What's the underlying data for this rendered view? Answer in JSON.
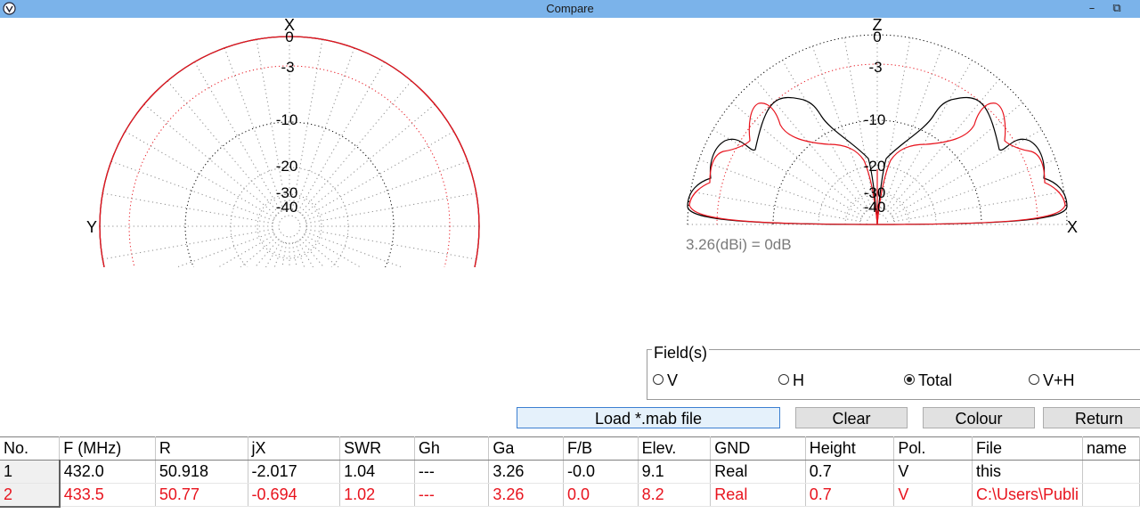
{
  "window": {
    "title": "Compare",
    "min_glyph": "–",
    "max_glyph": "⧉"
  },
  "azimuth_plot": {
    "top_axis": "X",
    "left_axis": "Y",
    "ring_labels": [
      "0",
      "-3",
      "-10",
      "-20",
      "-30",
      "-40"
    ]
  },
  "elevation_plot": {
    "top_axis": "Z",
    "right_axis": "X",
    "ring_labels": [
      "0",
      "-3",
      "-10",
      "-20",
      "-30",
      "-40"
    ],
    "reference": "3.26(dBi) = 0dB"
  },
  "fields": {
    "legend": "Field(s)",
    "options": [
      {
        "label": "V",
        "selected": false
      },
      {
        "label": "H",
        "selected": false
      },
      {
        "label": "Total",
        "selected": true
      },
      {
        "label": "V+H",
        "selected": false
      }
    ]
  },
  "buttons": {
    "load": "Load *.mab file",
    "clear": "Clear",
    "colour": "Colour",
    "return": "Return"
  },
  "table": {
    "headers": [
      "No.",
      "F (MHz)",
      "R",
      "jX",
      "SWR",
      "Gh",
      "Ga",
      "F/B",
      "Elev.",
      "GND",
      "Height",
      "Pol.",
      "File",
      "name"
    ],
    "rows": [
      [
        "1",
        "432.0",
        "50.918",
        "-2.017",
        "1.04",
        "---",
        "3.26",
        "-0.0",
        "9.1",
        "Real",
        "0.7",
        "V",
        "this",
        ""
      ],
      [
        "2",
        "433.5",
        "50.77",
        "-0.694",
        "1.02",
        "---",
        "3.26",
        "0.0",
        "8.2",
        "Real",
        "0.7",
        "V",
        "C:\\Users\\Publi",
        ""
      ]
    ]
  },
  "colors": {
    "trace1": "#000000",
    "trace2": "#e8141e",
    "titlebar": "#7bb3ea",
    "grid_gray": "#8c8c8c"
  }
}
